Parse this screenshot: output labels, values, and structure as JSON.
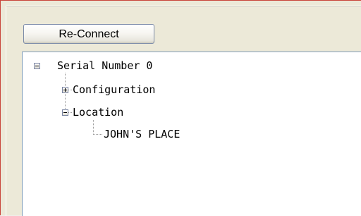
{
  "toolbar": {
    "reconnect_label": "Re-Connect"
  },
  "tree": {
    "root": {
      "label": "Serial Number 0",
      "expanded": true,
      "children": [
        {
          "label": "Configuration",
          "expanded": false
        },
        {
          "label": "Location",
          "expanded": true,
          "children": [
            {
              "label": "JOHN'S PLACE"
            }
          ]
        }
      ]
    }
  },
  "colors": {
    "window_background": "#ece9d8",
    "tree_background": "#ffffff",
    "tree_border": "#7f9db9",
    "button_border": "#7a8aa8",
    "frame_accent": "#c9443a"
  },
  "icons": {
    "expand": "plus-box-icon",
    "collapse": "minus-box-icon"
  }
}
